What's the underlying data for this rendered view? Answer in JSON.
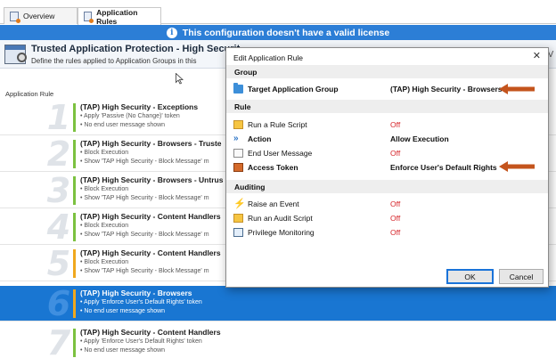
{
  "tabs": [
    {
      "label": "Overview"
    },
    {
      "label": "Application Rules"
    }
  ],
  "banner": {
    "text": "This configuration doesn't have a valid license"
  },
  "header": {
    "title": "Trusted Application Protection - High Securit",
    "subtitle": "Define the rules applied to Application Groups in this"
  },
  "column_label": "Application Rule",
  "rules": [
    {
      "num": "1",
      "title": "(TAP) High Security - Exceptions",
      "lines": [
        "• Apply 'Passive (No Change)' token",
        "• No end user message shown"
      ],
      "bar": "green"
    },
    {
      "num": "2",
      "title": "(TAP) High Security - Browsers - Truste",
      "lines": [
        "• Block Execution",
        "• Show 'TAP High Security - Block Message' m"
      ],
      "bar": "green"
    },
    {
      "num": "3",
      "title": "(TAP) High Security - Browsers - Untrus",
      "lines": [
        "• Block Execution",
        "• Show 'TAP High Security - Block Message' m"
      ],
      "bar": "green"
    },
    {
      "num": "4",
      "title": "(TAP) High Security - Content Handlers",
      "lines": [
        "• Block Execution",
        "• Show 'TAP High Security - Block Message' m"
      ],
      "bar": "green"
    },
    {
      "num": "5",
      "title": "(TAP) High Security - Content Handlers",
      "lines": [
        "• Block Execution",
        "• Show 'TAP High Security - Block Message' m"
      ],
      "bar": "orange"
    },
    {
      "num": "6",
      "title": "(TAP) High Security - Browsers",
      "lines": [
        "• Apply 'Enforce User's Default Rights' token",
        "• No end user message shown"
      ],
      "bar": "orange",
      "selected": true
    },
    {
      "num": "7",
      "title": "(TAP) High Security - Content Handlers",
      "lines": [
        "• Apply 'Enforce User's Default Rights' token",
        "• No end user message shown"
      ],
      "bar": "green"
    }
  ],
  "dialog": {
    "title": "Edit Application Rule",
    "close": "✕",
    "sections": {
      "group": "Group",
      "rule": "Rule",
      "auditing": "Auditing"
    },
    "group_row": {
      "label": "Target Application Group",
      "value": "(TAP) High Security - Browsers",
      "icon": "folder-icon"
    },
    "rule_rows": [
      {
        "label": "Run a Rule Script",
        "value": "Off",
        "icon": "script-icon"
      },
      {
        "label": "Action",
        "value": "Allow Execution",
        "icon": "action-arrow-icon"
      },
      {
        "label": "End User Message",
        "value": "Off",
        "icon": "message-icon"
      },
      {
        "label": "Access Token",
        "value": "Enforce User's Default Rights",
        "icon": "token-icon"
      }
    ],
    "auditing_rows": [
      {
        "label": "Raise an Event",
        "value": "Off",
        "icon": "event-icon"
      },
      {
        "label": "Run an Audit Script",
        "value": "Off",
        "icon": "script-icon"
      },
      {
        "label": "Privilege Monitoring",
        "value": "Off",
        "icon": "monitor-icon"
      }
    ],
    "ok": "OK",
    "cancel": "Cancel"
  },
  "colors": {
    "banner": "#2c7ed6",
    "selected_row": "#1976d2",
    "off_value": "#d6262b",
    "annotation_arrow": "#c4541d",
    "bar_green": "#7cc140",
    "bar_orange": "#f0a81e"
  }
}
